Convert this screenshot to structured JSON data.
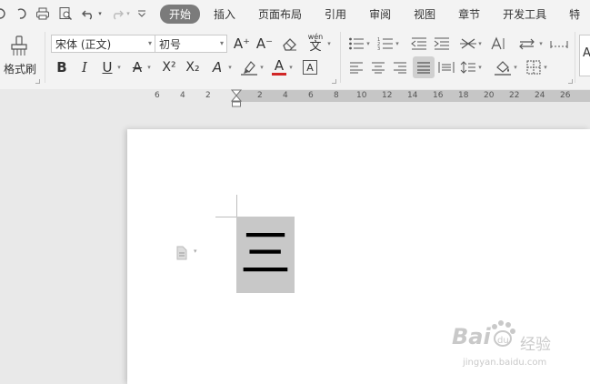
{
  "quick_access": {
    "icons": [
      "redo-arc-icon",
      "print-preview-icon",
      "print-icon",
      "zoom-preview-icon",
      "undo-icon",
      "redo-icon",
      "more-icon"
    ]
  },
  "tabs": [
    "开始",
    "插入",
    "页面布局",
    "引用",
    "审阅",
    "视图",
    "章节",
    "开发工具",
    "特"
  ],
  "active_tab": "开始",
  "ribbon": {
    "format_painter_label": "格式刷",
    "font_name": "宋体 (正文)",
    "font_size": "初号",
    "style_preview": "A",
    "text_buttons": {
      "grow": "A⁺",
      "shrink": "A⁻",
      "phonetic": "wén",
      "bold": "B",
      "italic": "I",
      "underline": "U",
      "strike": "A",
      "superscript": "X²",
      "subscript": "X₂",
      "text_effect": "A",
      "font_color": "A",
      "char_border": "A"
    }
  },
  "ruler": {
    "left_ticks": [
      "6",
      "4",
      "2"
    ],
    "right_ticks": [
      "2",
      "4",
      "6",
      "8",
      "10",
      "12",
      "14",
      "16",
      "18",
      "20",
      "22",
      "24",
      "26"
    ]
  },
  "document": {
    "text": "三"
  },
  "watermark": {
    "brand": "Bai",
    "logo_text": "du",
    "jingyan": "经验",
    "url": "jingyan.baidu.com"
  },
  "colors": {
    "active_tab_bg": "#7b7b7b",
    "selection_bg": "#c8c8c8",
    "ruler_active": "#c6c6c6",
    "font_color_bar": "#d12727"
  }
}
